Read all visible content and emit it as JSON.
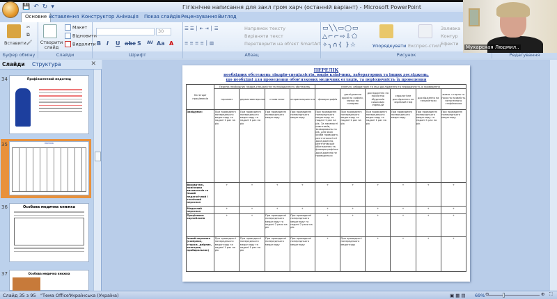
{
  "window": {
    "title": "Гігієнічне написання для закл гром харч (останній варіант) - Microsoft PowerPoint"
  },
  "ribbon": {
    "tabs": [
      "Основне",
      "Вставлення",
      "Конструктор",
      "Анімація",
      "Показ слайдів",
      "Рецензування",
      "Вигляд"
    ],
    "clipboard": {
      "paste": "Вставити",
      "label": "Буфер обміну"
    },
    "slides": {
      "new_slide": "Створити слайд",
      "layout": "Макет",
      "reset": "Відновити",
      "delete": "Видалити",
      "label": "Слайди"
    },
    "font": {
      "size": "30",
      "label": "Шрифт"
    },
    "paragraph": {
      "text_direction": "Напрямок тексту",
      "align_text": "Вирівняти текст",
      "smartart": "Перетворити на об'єкт SmartArt",
      "label": "Абзац"
    },
    "drawing": {
      "arrange": "Упорядкувати",
      "quick_styles": "Експрес-стилі",
      "fill": "Заливка",
      "outline": "Контур",
      "effects": "Ефекти",
      "label": "Рисунок"
    },
    "editing": {
      "label": "Редагування"
    }
  },
  "webcam": {
    "name": "Мухарская Людмил.."
  },
  "panel": {
    "tabs": [
      "Слайди",
      "Структура"
    ],
    "close": "✕",
    "slides": [
      {
        "num": "34",
        "title": "Профілактичний медогляд"
      },
      {
        "num": "35",
        "title": "ПЕРЕЛІК"
      },
      {
        "num": "36",
        "title": "Особова медична книжка"
      },
      {
        "num": "37",
        "title": "Особова медична книжка"
      }
    ]
  },
  "slide": {
    "title": "ПЕРЕЛІК",
    "subtitle1": "необхідних обстежень лікарів-спеціалістів, видів клінічних, лабораторних та інших досліджень,",
    "subtitle2": "що необхідні для проведення обов'язкових медичних оглядів, та періодичність їх проведення",
    "table": {
      "cat_header": "Категорії працівників",
      "group1": "Перелік необхідних лікарів-спеціалістів та періодичність обстежень",
      "group2": "Клінічні, лабораторні та інші дослідження та періодичність їх проведення",
      "columns": [
        "терапевт",
        "дерматовенеролог",
        "стоматолог",
        "оториноларинголог",
        "флюорографія",
        "дослідження крові на сифіліс, мазки на гонорею",
        "дослідження на носійство збудників кишкових інфекцій",
        "серологічне дослідження на черевний тиф",
        "дослідження на гельмінтози",
        "мазок з горла та носа на наявність патогенного стафілокока"
      ],
      "rows": [
        {
          "category": "Завідувачі",
          "cells": [
            "При проведенні попереднього медогляду та надалі 1 раз на рік",
            "При проведенні попереднього медогляду та надалі 1 раз на рік",
            "При проведенні попереднього медогляду",
            "При проведенні попереднього медогляду",
            "При проведенні попереднього медогляду та надалі 1 раз на рік. За наявності симптомів, захворювань на рік, для яких особи проводять рентгенологічні дослідження, рентгенівське обстеження та флюорографічне дослідження не проводяться",
            "При проведенні попереднього медогляду та надалі 1 раз на рік",
            "При проведенні попереднього медогляду та надалі 1 раз на рік",
            "При проведенні попереднього медогляду",
            "При проведенні попереднього медогляду та надалі 1 раз на рік",
            "При проведенні попереднього медогляду"
          ]
        },
        {
          "category": "Вихователі, помічники вихователів та інший педагогічний і технічний персонал",
          "cells": [
            "+",
            "+",
            "+",
            "+",
            "+",
            "+",
            "+",
            "+",
            "+",
            "+"
          ]
        },
        {
          "category": "Медичний персонал",
          "cells": [
            "+",
            "+",
            "+",
            "+",
            "+",
            "+",
            "+",
            "+",
            "+",
            "+"
          ]
        },
        {
          "category": "Працівники харчоблоків",
          "cells": [
            "+",
            "+",
            "При проведенні попереднього медогляду та надалі 2 рази на рік",
            "При проведенні попереднього медогляду та надалі 2 рази на рік",
            "+",
            "+",
            "+",
            "+",
            "+",
            "+"
          ]
        },
        {
          "category": "Інший персонал (комірник, сторож, двірник, електрик, прибиральник)",
          "cells": [
            "При проведенні попереднього медогляду та надалі 1 раз на рік",
            "При проведенні попереднього медогляду та надалі 1 раз на рік",
            "При проведенні попереднього медогляду",
            "При проведенні попереднього медогляду",
            "+",
            "При проведенні попереднього медогляду",
            "+",
            "+",
            "+",
            "+"
          ]
        }
      ]
    }
  },
  "status": {
    "slide": "Слайд 35 з 95",
    "theme": "\"Тема Office\"",
    "language": "Українська (Україна)",
    "zoom": "69%"
  }
}
